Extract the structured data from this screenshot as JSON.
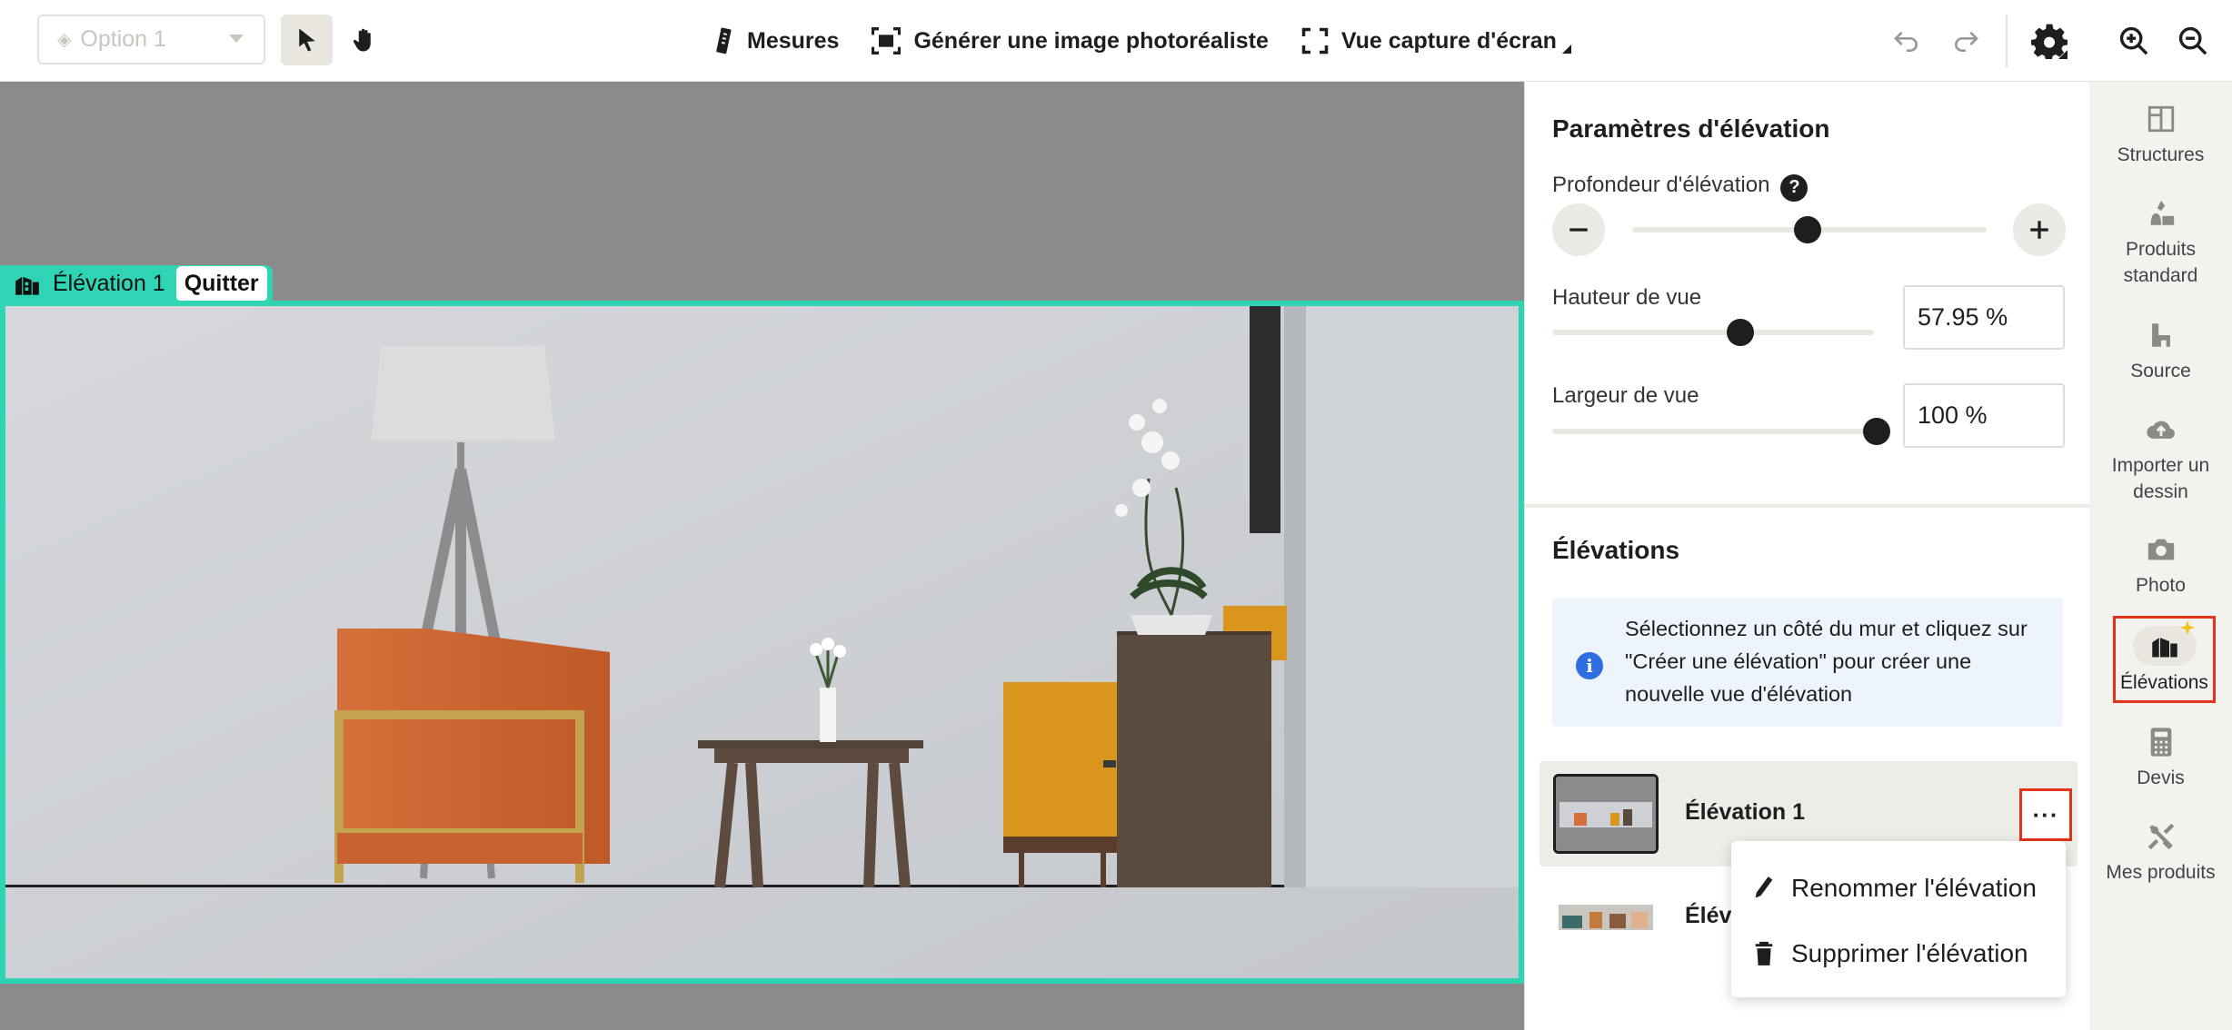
{
  "toolbar": {
    "option_value": "Option 1",
    "actions": [
      {
        "label": "Mesures",
        "icon": "ruler-icon"
      },
      {
        "label": "Générer une image photoréaliste",
        "icon": "photoreal-icon"
      },
      {
        "label": "Vue capture d'écran",
        "icon": "screenshot-frame-icon"
      }
    ]
  },
  "canvas": {
    "elevation_tag": "Élévation 1",
    "quit_label": "Quitter"
  },
  "panel": {
    "params_title": "Paramètres d'élévation",
    "depth_label": "Profondeur d'élévation",
    "depth_level": 0.5,
    "height_label": "Hauteur de vue",
    "height_value": "57.95 %",
    "width_label": "Largeur de vue",
    "width_value": "100 %",
    "elevations_title": "Élévations",
    "info_text": "Sélectionnez un côté du mur et cliquez sur \"Créer une élévation\" pour créer une nouvelle vue d'élévation",
    "elevations": [
      {
        "name": "Élévation 1"
      },
      {
        "name": "Éléva"
      }
    ],
    "more_label": "···",
    "menu": [
      {
        "label": "Renommer l'élévation",
        "icon": "pencil-icon"
      },
      {
        "label": "Supprimer l'élévation",
        "icon": "trash-icon"
      }
    ]
  },
  "rail": {
    "items": [
      {
        "label": "Structures",
        "icon": "structures-icon"
      },
      {
        "label": "Produits standard",
        "icon": "products-icon"
      },
      {
        "label": "Source",
        "icon": "source-icon"
      },
      {
        "label": "Importer un dessin",
        "icon": "upload-cloud-icon"
      },
      {
        "label": "Photo",
        "icon": "camera-icon"
      },
      {
        "label": "Élévations",
        "icon": "elevation-icon"
      },
      {
        "label": "Devis",
        "icon": "calculator-icon"
      },
      {
        "label": "Mes produits",
        "icon": "my-products-icon"
      }
    ]
  },
  "colors": {
    "accent_teal": "#2fd4b5",
    "highlight_red": "#e2331b",
    "info_blue": "#2d6fe0"
  }
}
